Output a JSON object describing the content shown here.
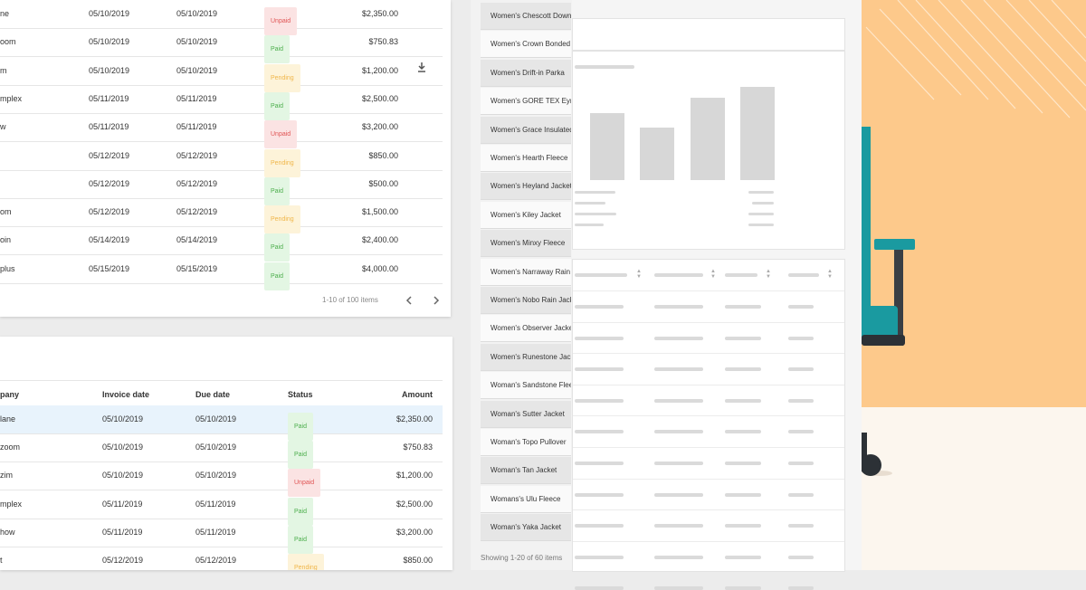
{
  "invoices_top": {
    "rows": [
      {
        "company": "ne",
        "invoice_date": "05/10/2019",
        "due_date": "05/10/2019",
        "status": "Unpaid",
        "amount": "$2,350.00"
      },
      {
        "company": "oom",
        "invoice_date": "05/10/2019",
        "due_date": "05/10/2019",
        "status": "Paid",
        "amount": "$750.83"
      },
      {
        "company": "m",
        "invoice_date": "05/10/2019",
        "due_date": "05/10/2019",
        "status": "Pending",
        "amount": "$1,200.00"
      },
      {
        "company": "mplex",
        "invoice_date": "05/11/2019",
        "due_date": "05/11/2019",
        "status": "Paid",
        "amount": "$2,500.00"
      },
      {
        "company": "w",
        "invoice_date": "05/11/2019",
        "due_date": "05/11/2019",
        "status": "Unpaid",
        "amount": "$3,200.00"
      },
      {
        "company": "",
        "invoice_date": "05/12/2019",
        "due_date": "05/12/2019",
        "status": "Pending",
        "amount": "$850.00"
      },
      {
        "company": "",
        "invoice_date": "05/12/2019",
        "due_date": "05/12/2019",
        "status": "Paid",
        "amount": "$500.00"
      },
      {
        "company": "om",
        "invoice_date": "05/12/2019",
        "due_date": "05/12/2019",
        "status": "Pending",
        "amount": "$1,500.00"
      },
      {
        "company": "oin",
        "invoice_date": "05/14/2019",
        "due_date": "05/14/2019",
        "status": "Paid",
        "amount": "$2,400.00"
      },
      {
        "company": "plus",
        "invoice_date": "05/15/2019",
        "due_date": "05/15/2019",
        "status": "Paid",
        "amount": "$4,000.00"
      }
    ],
    "pagination": "1-10 of 100 items"
  },
  "invoices_bottom": {
    "headers": {
      "company": "pany",
      "invoice_date": "Invoice date",
      "due_date": "Due date",
      "status": "Status",
      "amount": "Amount"
    },
    "rows": [
      {
        "company": "lane",
        "invoice_date": "05/10/2019",
        "due_date": "05/10/2019",
        "status": "Paid",
        "amount": "$2,350.00"
      },
      {
        "company": "zoom",
        "invoice_date": "05/10/2019",
        "due_date": "05/10/2019",
        "status": "Paid",
        "amount": "$750.83"
      },
      {
        "company": "zim",
        "invoice_date": "05/10/2019",
        "due_date": "05/10/2019",
        "status": "Unpaid",
        "amount": "$1,200.00"
      },
      {
        "company": "mplex",
        "invoice_date": "05/11/2019",
        "due_date": "05/11/2019",
        "status": "Paid",
        "amount": "$2,500.00"
      },
      {
        "company": "how",
        "invoice_date": "05/11/2019",
        "due_date": "05/11/2019",
        "status": "Paid",
        "amount": "$3,200.00"
      },
      {
        "company": "t",
        "invoice_date": "05/12/2019",
        "due_date": "05/12/2019",
        "status": "Pending",
        "amount": "$850.00"
      }
    ]
  },
  "products": {
    "items": [
      "Women's Chescott Down",
      "Women's Crown Bonded",
      "Women's Drift-in Parka",
      "Women's GORE TEX Eyrie",
      "Women's Grace Insulated",
      "Women's  Hearth Fleece",
      "Women's Heyland Jacket",
      "Women's Kiley Jacket",
      "Women's Minxy Fleece",
      "Women's Narraway Rain",
      "Women's Nobo Rain Jacket",
      "Women's Observer Jacket",
      "Women's Runestone Jacket",
      "Woman's Sandstone Fleece",
      "Woman's Sutter Jacket",
      "Woman's Topo Pullover",
      "Woman's Tan Jacket",
      "Womans's Ulu Fleece",
      "Woman's Yaka Jacket"
    ],
    "footer": "Showing 1-20 of 60 items"
  },
  "wireframe": {
    "placeholder_bars": [
      0.72,
      0.56,
      0.88,
      1.0
    ]
  },
  "colors": {
    "paid": "#4cae4c",
    "unpaid": "#e05555",
    "pending": "#f0b64a",
    "selected_row": "#e8f3fc",
    "illustration_bg": "#fdc98b",
    "chair": "#1a9aa0"
  },
  "icons": {
    "download": "download-icon",
    "prev": "chevron-left-icon",
    "next": "chevron-right-icon"
  }
}
